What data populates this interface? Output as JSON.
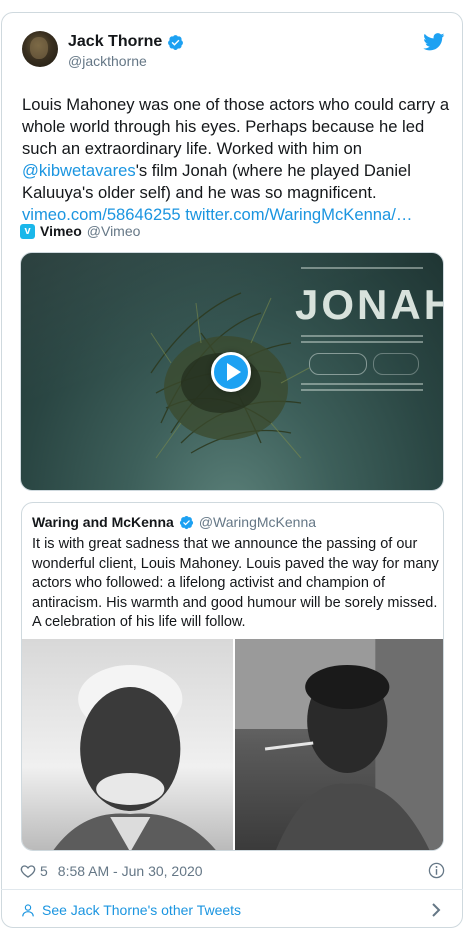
{
  "author": {
    "name": "Jack Thorne",
    "handle": "@jackthorne"
  },
  "tweet": {
    "lines": [
      "Louis Mahoney was one of those actors who could carry a",
      "whole world through his eyes. Perhaps because he led",
      "such an extraordinary life. Worked with him on",
      "'s film Jonah (where he played Daniel",
      "Kaluuya's older self) and he was so magnificent."
    ],
    "mention": "@kibwetavares",
    "link1": "vimeo.com/58646255",
    "link2": "twitter.com/WaringMcKenna/…"
  },
  "card": {
    "source_name": "Vimeo",
    "source_handle": "@Vimeo",
    "video_poster_title": "JONAH"
  },
  "quote": {
    "name": "Waring and McKenna",
    "handle": "@WaringMcKenna",
    "lines": [
      "It is with great sadness that we announce the passing of our",
      "wonderful client, Louis Mahoney. Louis paved the way for many",
      "actors who followed: a lifelong activist and champion of",
      "antiracism. His warmth and good humour will be sorely missed.",
      "A celebration of his life will follow."
    ]
  },
  "footer": {
    "likes": "5",
    "timestamp": "8:58 AM - Jun 30, 2020"
  },
  "other_tweets": "See Jack Thorne's other Tweets",
  "colors": {
    "link": "#1b95e0",
    "verified": "#1da1f2",
    "muted": "#657786",
    "border": "#cfd9de"
  },
  "icons": [
    "verified-icon",
    "twitter-bird-icon",
    "vimeo-logo-icon",
    "play-icon",
    "heart-icon",
    "info-icon",
    "person-icon",
    "chevron-right-icon"
  ]
}
